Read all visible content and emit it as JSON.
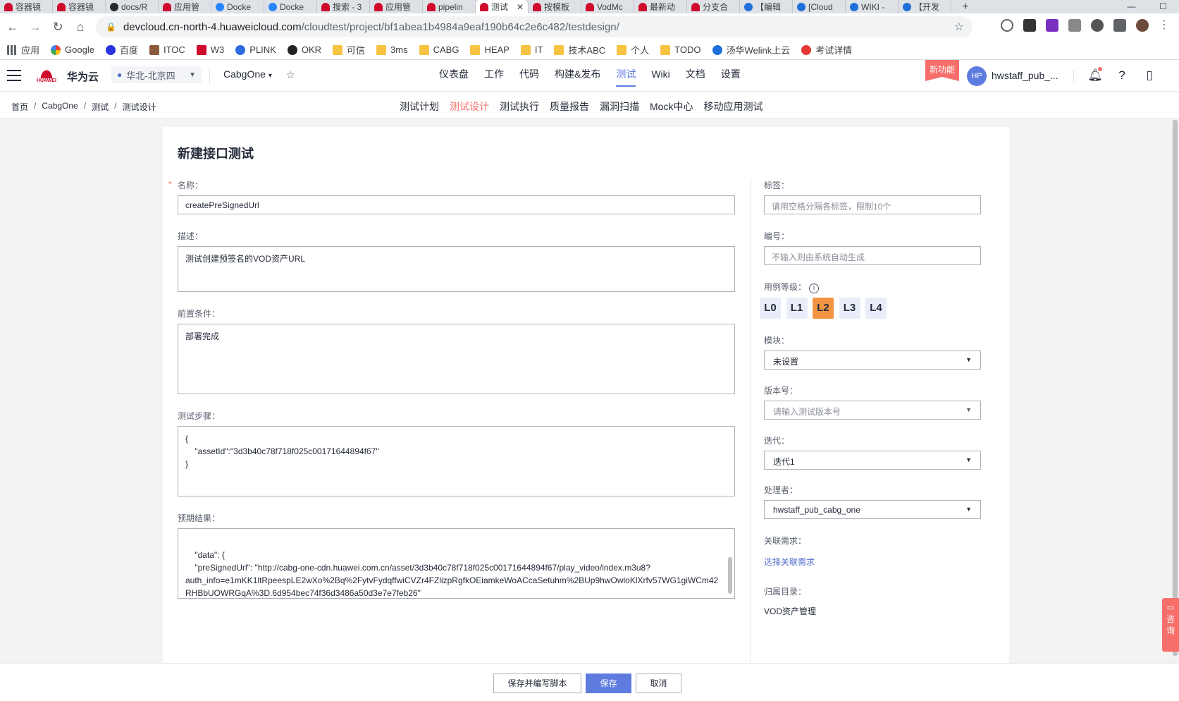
{
  "browser": {
    "tabs": [
      {
        "title": "容器镜",
        "icon": "hw"
      },
      {
        "title": "容器镜",
        "icon": "hw"
      },
      {
        "title": "docs/R",
        "icon": "gh"
      },
      {
        "title": "应用管",
        "icon": "hw"
      },
      {
        "title": "Docke",
        "icon": "dk"
      },
      {
        "title": "Docke",
        "icon": "dk"
      },
      {
        "title": "搜索 - 3",
        "icon": "hw"
      },
      {
        "title": "应用管",
        "icon": "hw"
      },
      {
        "title": "pipelin",
        "icon": "hw"
      },
      {
        "title": "测试",
        "icon": "hw",
        "active": true
      },
      {
        "title": "按模板",
        "icon": "hw"
      },
      {
        "title": "VodMc",
        "icon": "hw"
      },
      {
        "title": "最新动",
        "icon": "hw"
      },
      {
        "title": "分支合",
        "icon": "hw"
      },
      {
        "title": "【编辑",
        "icon": "hp"
      },
      {
        "title": "[Cloud",
        "icon": "hp"
      },
      {
        "title": "WIKI -",
        "icon": "hp"
      },
      {
        "title": "【开发",
        "icon": "hp"
      }
    ],
    "tab_close": "✕",
    "new_tab": "+",
    "url_host": "devcloud.cn-north-4.huaweicloud.com",
    "url_path": "/cloudtest/project/bf1abea1b4984a9eaf190b64c2e6c482/testdesign/",
    "bookmarks": [
      {
        "label": "应用",
        "icon": "grid"
      },
      {
        "label": "Google",
        "icon": "google"
      },
      {
        "label": "百度",
        "icon": "baidu"
      },
      {
        "label": "ITOC",
        "icon": "itoc"
      },
      {
        "label": "W3",
        "icon": "w3"
      },
      {
        "label": "PLINK",
        "icon": "plink"
      },
      {
        "label": "OKR",
        "icon": "okr"
      },
      {
        "label": "可信",
        "icon": "folder"
      },
      {
        "label": "3ms",
        "icon": "folder"
      },
      {
        "label": "CABG",
        "icon": "folder"
      },
      {
        "label": "HEAP",
        "icon": "folder"
      },
      {
        "label": "IT",
        "icon": "folder"
      },
      {
        "label": "技术ABC",
        "icon": "folder"
      },
      {
        "label": "个人",
        "icon": "folder"
      },
      {
        "label": "TODO",
        "icon": "folder"
      },
      {
        "label": "汤华Welink上云",
        "icon": "welink"
      },
      {
        "label": "考试详情",
        "icon": "exam"
      }
    ]
  },
  "header": {
    "brand": "华为云",
    "logo_text": "HUAWEI",
    "region": "华北-北京四",
    "project": "CabgOne",
    "nav": [
      "仪表盘",
      "工作",
      "代码",
      "构建&发布",
      "测试",
      "Wiki",
      "文档",
      "设置"
    ],
    "active_nav": "测试",
    "new_feature": "新功能",
    "avatar": "HP",
    "username": "hwstaff_pub_..."
  },
  "subheader": {
    "breadcrumb": [
      "首页",
      "CabgOne",
      "测试",
      "测试设计"
    ],
    "subnav": [
      "测试计划",
      "测试设计",
      "测试执行",
      "质量报告",
      "漏洞扫描",
      "Mock中心",
      "移动应用测试"
    ],
    "active_subnav": "测试设计"
  },
  "form": {
    "title": "新建接口测试",
    "name_label": "名称：",
    "name_value": "createPreSignedUrl",
    "desc_label": "描述：",
    "desc_value": "测试创建预签名的VOD资产URL",
    "precond_label": "前置条件：",
    "precond_value": "部署完成",
    "steps_label": "测试步骤：",
    "steps_value": "{\n    \"assetId\":\"3d3b40c78f718f025c00171644894f67\"\n}",
    "expected_label": "预期结果：",
    "expected_value": "    \"data\": {\n    \"preSignedUrl\": \"http://cabg-one-cdn.huawei.com.cn/asset/3d3b40c78f718f025c00171644894f67/play_video/index.m3u8?\nauth_info=e1mKK1ltRpeespLE2wXo%2Bq%2FytvFydqffwiCVZr4FZlizpRgfkOEiamkeWoACcaSetuhm%2BUp9hwOwloKlXrfv57WG1giWCm42\nRHBbUOWRGqA%3D.6d954bec74f36d3486a50d3e7e7feb26\"\n  }\n}",
    "tags_label": "标签：",
    "tags_placeholder": "请用空格分隔各标签，限制10个",
    "number_label": "编号：",
    "number_placeholder": "不输入则由系统自动生成",
    "level_label": "用例等级：",
    "levels": [
      "L0",
      "L1",
      "L2",
      "L3",
      "L4"
    ],
    "active_level": "L2",
    "module_label": "模块：",
    "module_value": "未设置",
    "version_label": "版本号：",
    "version_placeholder": "请输入测试版本号",
    "iteration_label": "迭代：",
    "iteration_value": "迭代1",
    "handler_label": "处理者：",
    "handler_value": "hwstaff_pub_cabg_one",
    "related_label": "关联需求：",
    "related_link": "选择关联需求",
    "dir_label": "归属目录：",
    "dir_value": "VOD资产管理"
  },
  "footer": {
    "save_and_script": "保存并编写脚本",
    "save": "保存",
    "cancel": "取消"
  },
  "float_consult": "咨询",
  "colors": {
    "accent": "#5e7ce0",
    "active_sub": "#f66f6a",
    "level_active": "#f29443",
    "huawei_red": "#cf0a2c"
  }
}
